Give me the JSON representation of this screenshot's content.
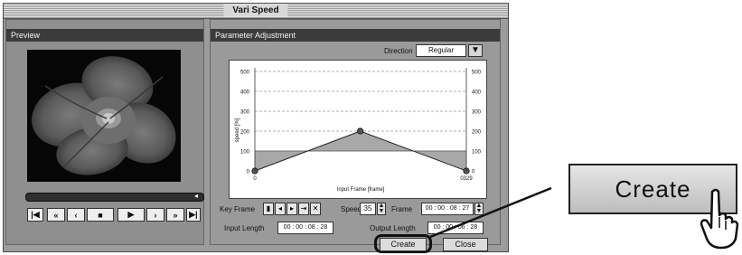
{
  "window": {
    "title": "Vari Speed"
  },
  "preview": {
    "header": "Preview",
    "seek_marker": "◂"
  },
  "transport": [
    {
      "name": "go-start-button",
      "glyph": "|◀"
    },
    {
      "name": "rewind-button",
      "glyph": "«"
    },
    {
      "name": "step-back-button",
      "glyph": "‹"
    },
    {
      "name": "stop-button",
      "glyph": "■"
    },
    {
      "name": "play-button",
      "glyph": "▶"
    },
    {
      "name": "step-forward-button",
      "glyph": "›"
    },
    {
      "name": "fast-forward-button",
      "glyph": "»"
    },
    {
      "name": "go-end-button",
      "glyph": "▶|"
    }
  ],
  "parameter": {
    "header": "Parameter Adjustment",
    "direction_label": "Direction",
    "direction_value": "Regular"
  },
  "chart_data": {
    "type": "line",
    "xlabel": "Input Frame [frame]",
    "ylabel": "speed [%]",
    "ylim": [
      0,
      500
    ],
    "xlim": [
      0,
      329
    ],
    "y_ticks": [
      "500",
      "400",
      "300",
      "200",
      "100",
      "0"
    ],
    "x_tick_left": "0",
    "x_tick_right": "0329",
    "reference_level": 100,
    "grid": true,
    "series": [
      {
        "x": [
          0,
          164,
          329
        ],
        "y": [
          0,
          200,
          0
        ]
      }
    ]
  },
  "keyframe": {
    "label": "Key Frame",
    "speed_label": "Speed",
    "speed_value": "35",
    "frame_label": "Frame",
    "frame_value": "00 : 00 : 08 : 27"
  },
  "lengths": {
    "input_label": "Input Length",
    "input_value": "00 : 00 : 08 : 28",
    "output_label": "Output Length",
    "output_value": "00 : 00 : 06 : 28"
  },
  "buttons": {
    "create": "Create",
    "close": "Close"
  },
  "callout": {
    "label": "Create"
  }
}
